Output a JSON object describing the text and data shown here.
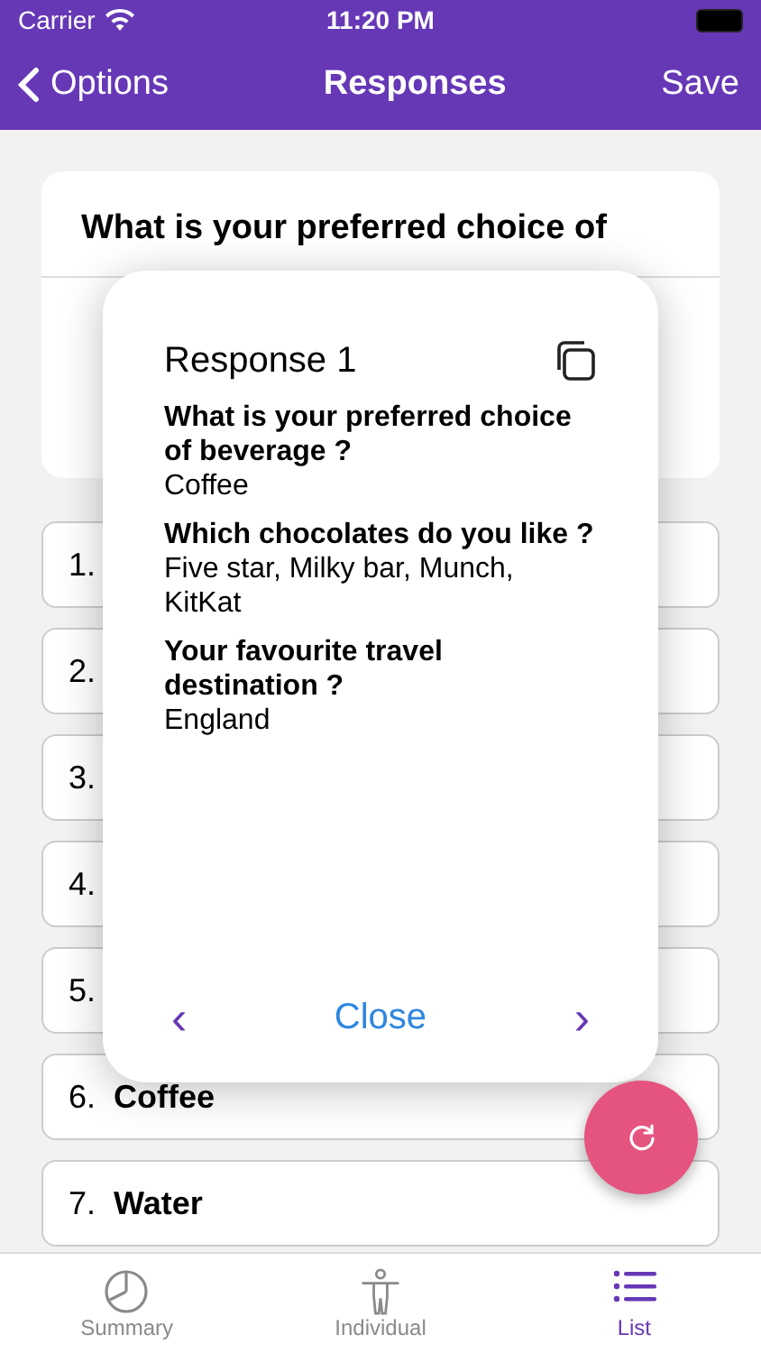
{
  "status_bar": {
    "carrier": "Carrier",
    "time": "11:20 PM"
  },
  "nav": {
    "back": "Options",
    "title": "Responses",
    "action": "Save"
  },
  "question": {
    "title": "What is your preferred choice of"
  },
  "answers": [
    {
      "number": "1."
    },
    {
      "number": "2."
    },
    {
      "number": "3."
    },
    {
      "number": "4."
    },
    {
      "number": "5."
    },
    {
      "number": "6.",
      "text": "Coffee"
    },
    {
      "number": "7.",
      "text": "Water"
    }
  ],
  "popup": {
    "title": "Response 1",
    "items": [
      {
        "question": "What is your preferred choice of beverage ?",
        "answer": "Coffee"
      },
      {
        "question": "Which chocolates do you like ?",
        "answer": "Five star, Milky bar, Munch, KitKat"
      },
      {
        "question": "Your favourite travel destination ?",
        "answer": "England"
      }
    ],
    "prev": "‹",
    "close": "Close",
    "next": "›"
  },
  "tabs": [
    {
      "label": "Summary",
      "kind": "chart",
      "selected": false
    },
    {
      "label": "Individual",
      "kind": "person",
      "selected": false
    },
    {
      "label": "List",
      "kind": "list",
      "selected": true
    }
  ]
}
